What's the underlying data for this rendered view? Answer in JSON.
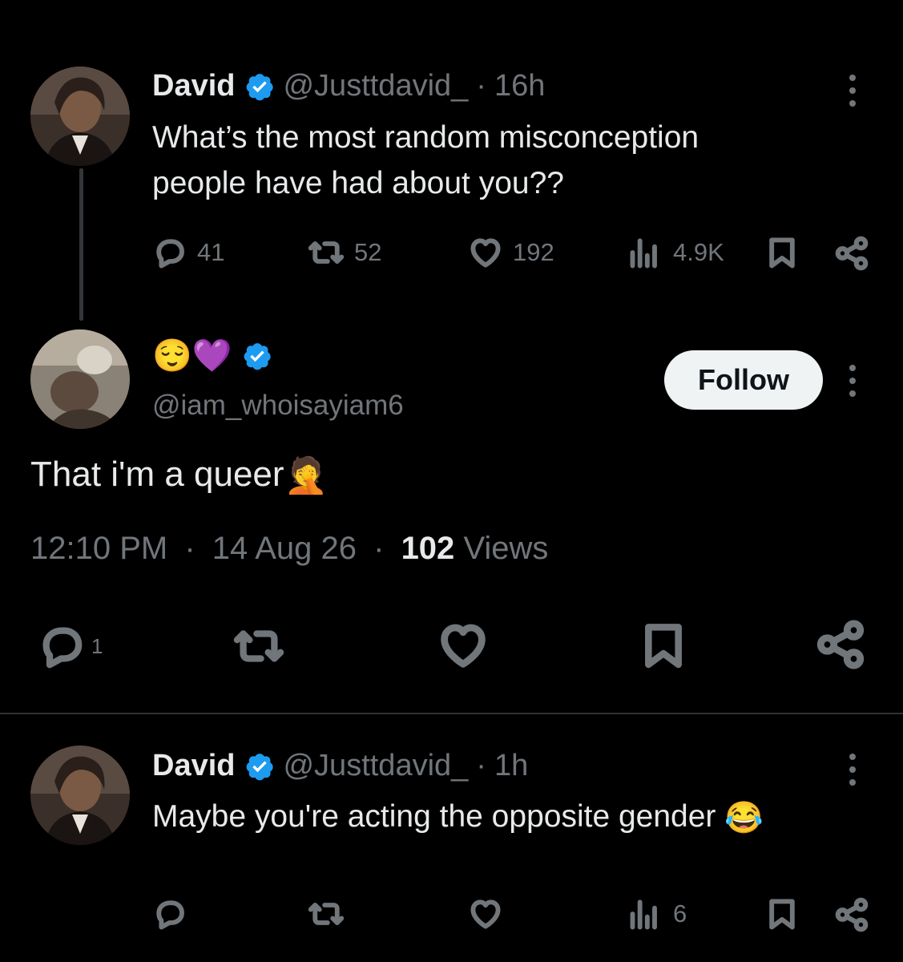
{
  "tweet1": {
    "name": "David",
    "handle": "@Justtdavid_",
    "separator": "·",
    "time": "16h",
    "text_line1": "What’s the most random misconception",
    "text_line2": "people have had about you??",
    "replies": "41",
    "reposts": "52",
    "likes": "192",
    "views": "4.9K"
  },
  "tweet2": {
    "name_emojis": "😌💜",
    "handle": "@iam_whoisayiam6",
    "follow_label": "Follow",
    "text": "That i'm a queer",
    "text_emoji": "🤦",
    "time": "12:10 PM",
    "separator": "·",
    "date": "14 Aug 26",
    "views_count": "102",
    "views_label": "Views",
    "replies": "1"
  },
  "tweet3": {
    "name": "David",
    "handle": "@Justtdavid_",
    "separator": "·",
    "time": "1h",
    "text": "Maybe you're acting the opposite gender",
    "text_emoji": "😂",
    "views": "6"
  },
  "icons": [
    "verified-badge-icon",
    "grok-icon",
    "more-icon",
    "reply-icon",
    "repost-icon",
    "like-icon",
    "views-icon",
    "bookmark-icon",
    "share-icon"
  ],
  "colors": {
    "background": "#000000",
    "text": "#e7e9ea",
    "muted": "#71767b",
    "verified": "#1d9bf0",
    "follow_bg": "#eff3f4"
  }
}
